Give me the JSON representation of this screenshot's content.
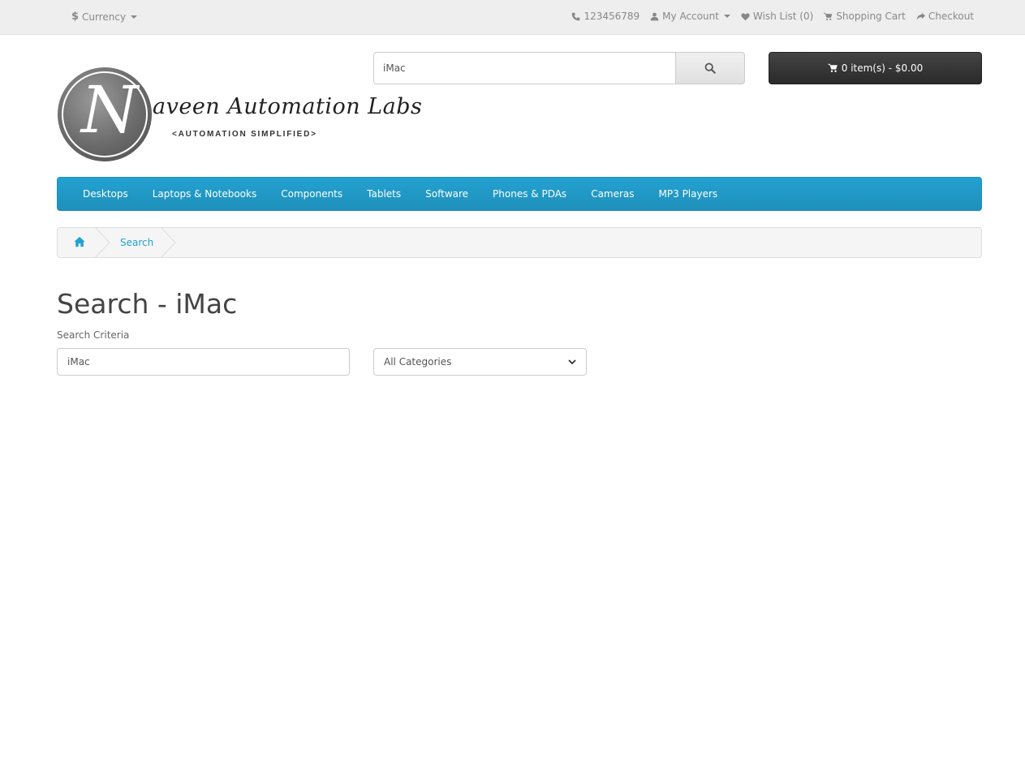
{
  "topbar": {
    "currency_symbol": "$",
    "currency_label": "Currency",
    "phone": "123456789",
    "my_account": "My Account",
    "wish_list": "Wish List (0)",
    "shopping_cart": "Shopping Cart",
    "checkout": "Checkout"
  },
  "logo": {
    "letter": "N",
    "title": "aveen Automation Labs",
    "subtitle": "<AUTOMATION SIMPLIFIED>"
  },
  "header_search": {
    "value": "iMac"
  },
  "cart": {
    "label": "0 item(s) - $0.00"
  },
  "menu": {
    "items": [
      "Desktops",
      "Laptops & Notebooks",
      "Components",
      "Tablets",
      "Software",
      "Phones & PDAs",
      "Cameras",
      "MP3 Players"
    ]
  },
  "breadcrumb": {
    "current": "Search"
  },
  "page": {
    "title": "Search - iMac",
    "criteria_label": "Search Criteria",
    "criteria_value": "iMac",
    "category_selected": "All Categories"
  },
  "colors": {
    "accent": "#23a1d1",
    "topbar_bg": "#eeeeee",
    "cart_bg": "#363636"
  }
}
